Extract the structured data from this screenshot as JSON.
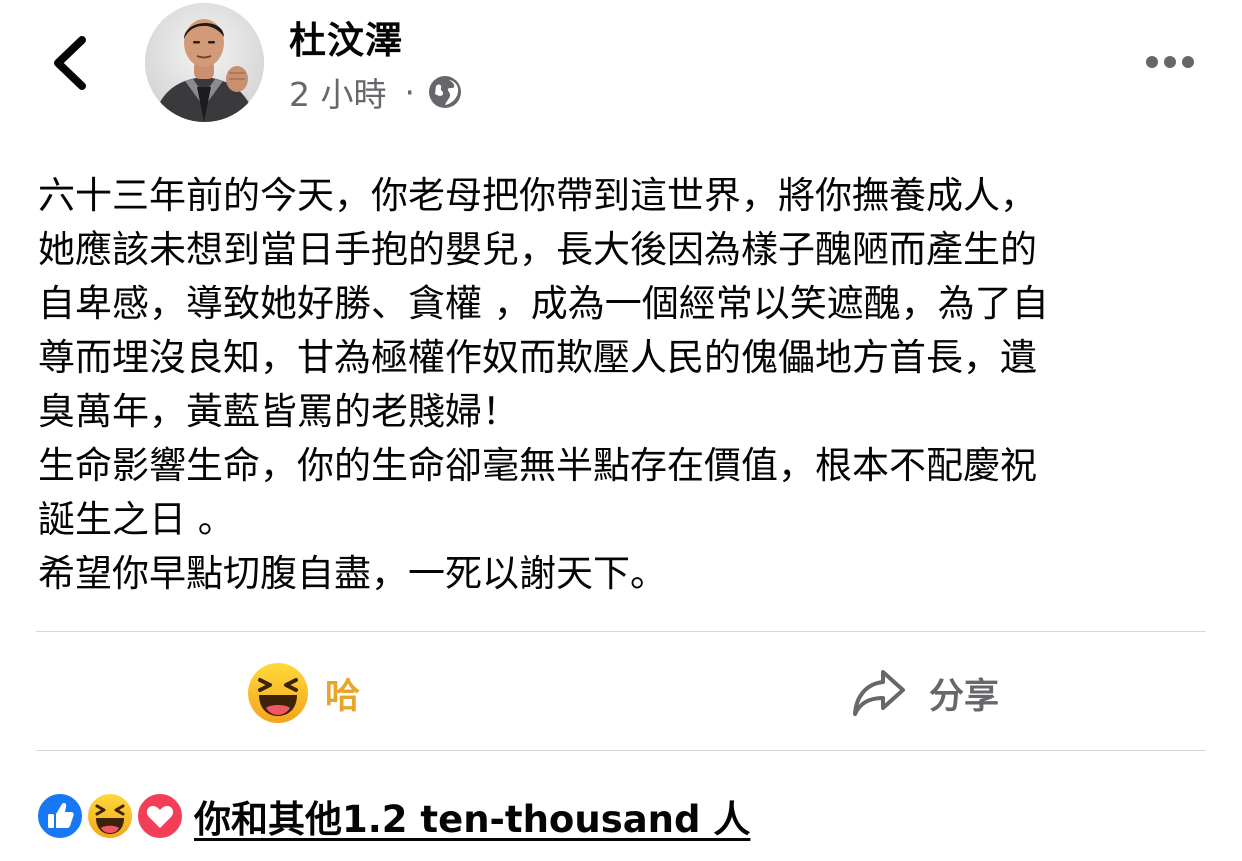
{
  "header": {
    "back_icon": "chevron-left-icon",
    "author_name": "杜汶澤",
    "timestamp": "2 小時",
    "separator": "·",
    "audience_icon": "globe-icon",
    "more_icon": "more-horizontal-icon"
  },
  "post": {
    "lines": [
      "六十三年前的今天，你老母把你帶到這世界，將你撫養成人，",
      "她應該未想到當日手抱的嬰兒，長大後因為樣子醜陋而產生的",
      "自卑感，導致她好勝、貪權 ，成為一個經常以笑遮醜，為了自",
      "尊而埋沒良知，甘為極權作奴而欺壓人民的傀儡地方首長，遺",
      "臭萬年，黃藍皆罵的老賤婦！",
      "生命影響生命，你的生命卻毫無半點存在價值，根本不配慶祝",
      "誕生之日 。",
      "希望你早點切腹自盡，一死以謝天下。"
    ]
  },
  "actions": {
    "haha_label": "哈",
    "haha_icon": "haha-emoji-icon",
    "share_label": "分享",
    "share_icon": "share-arrow-icon"
  },
  "reactions": {
    "icons": [
      "like-icon",
      "haha-icon",
      "love-icon"
    ],
    "summary": "你和其他1.2 ten-thousand 人"
  },
  "colors": {
    "haha_yellow": "#e7a62a",
    "secondary_text": "#65676b",
    "like_blue": "#1877f2",
    "love_red": "#f33e58",
    "divider": "#d5d7db"
  }
}
